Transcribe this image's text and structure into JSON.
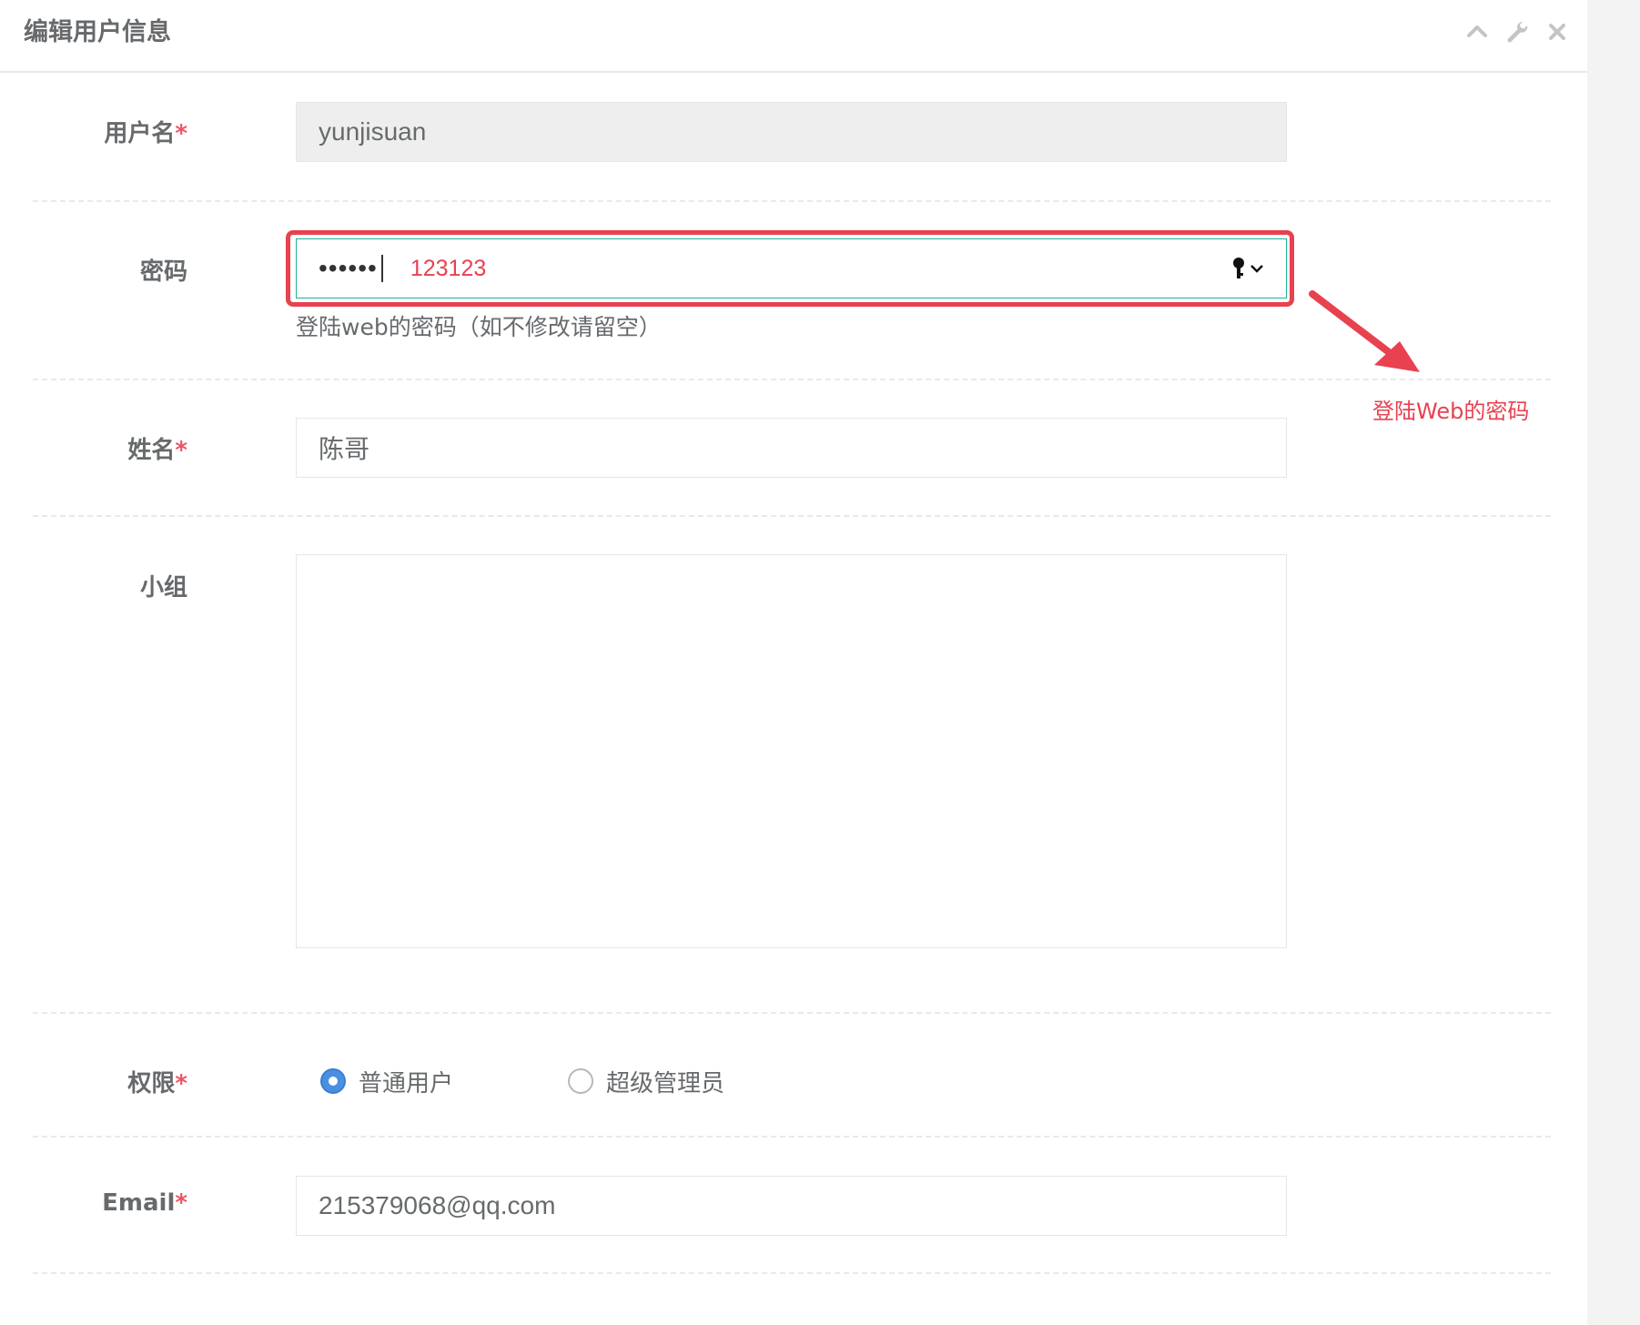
{
  "panel": {
    "title": "编辑用户信息",
    "tools": [
      "chevron-up-icon",
      "wrench-icon",
      "close-icon"
    ]
  },
  "form": {
    "username": {
      "label": "用户名",
      "required_mark": "*",
      "value": "yunjisuan"
    },
    "password": {
      "label": "密码",
      "masked_value": "••••••",
      "annotation_value": "123123",
      "help": "登陆web的密码（如不修改请留空）"
    },
    "name": {
      "label": "姓名",
      "required_mark": "*",
      "value": "陈哥"
    },
    "group": {
      "label": "小组",
      "value": ""
    },
    "permission": {
      "label": "权限",
      "required_mark": "*",
      "options": [
        {
          "label": "普通用户",
          "checked": true
        },
        {
          "label": "超级管理员",
          "checked": false
        }
      ]
    },
    "email": {
      "label": "Email",
      "required_mark": "*",
      "value": "215379068@qq.com"
    }
  },
  "annotation": {
    "text": "登陆Web的密码",
    "color": "#e84150"
  },
  "colors": {
    "focus_border": "#1ab394",
    "required": "#ed5565",
    "radio_checked": "#4a90e2"
  }
}
